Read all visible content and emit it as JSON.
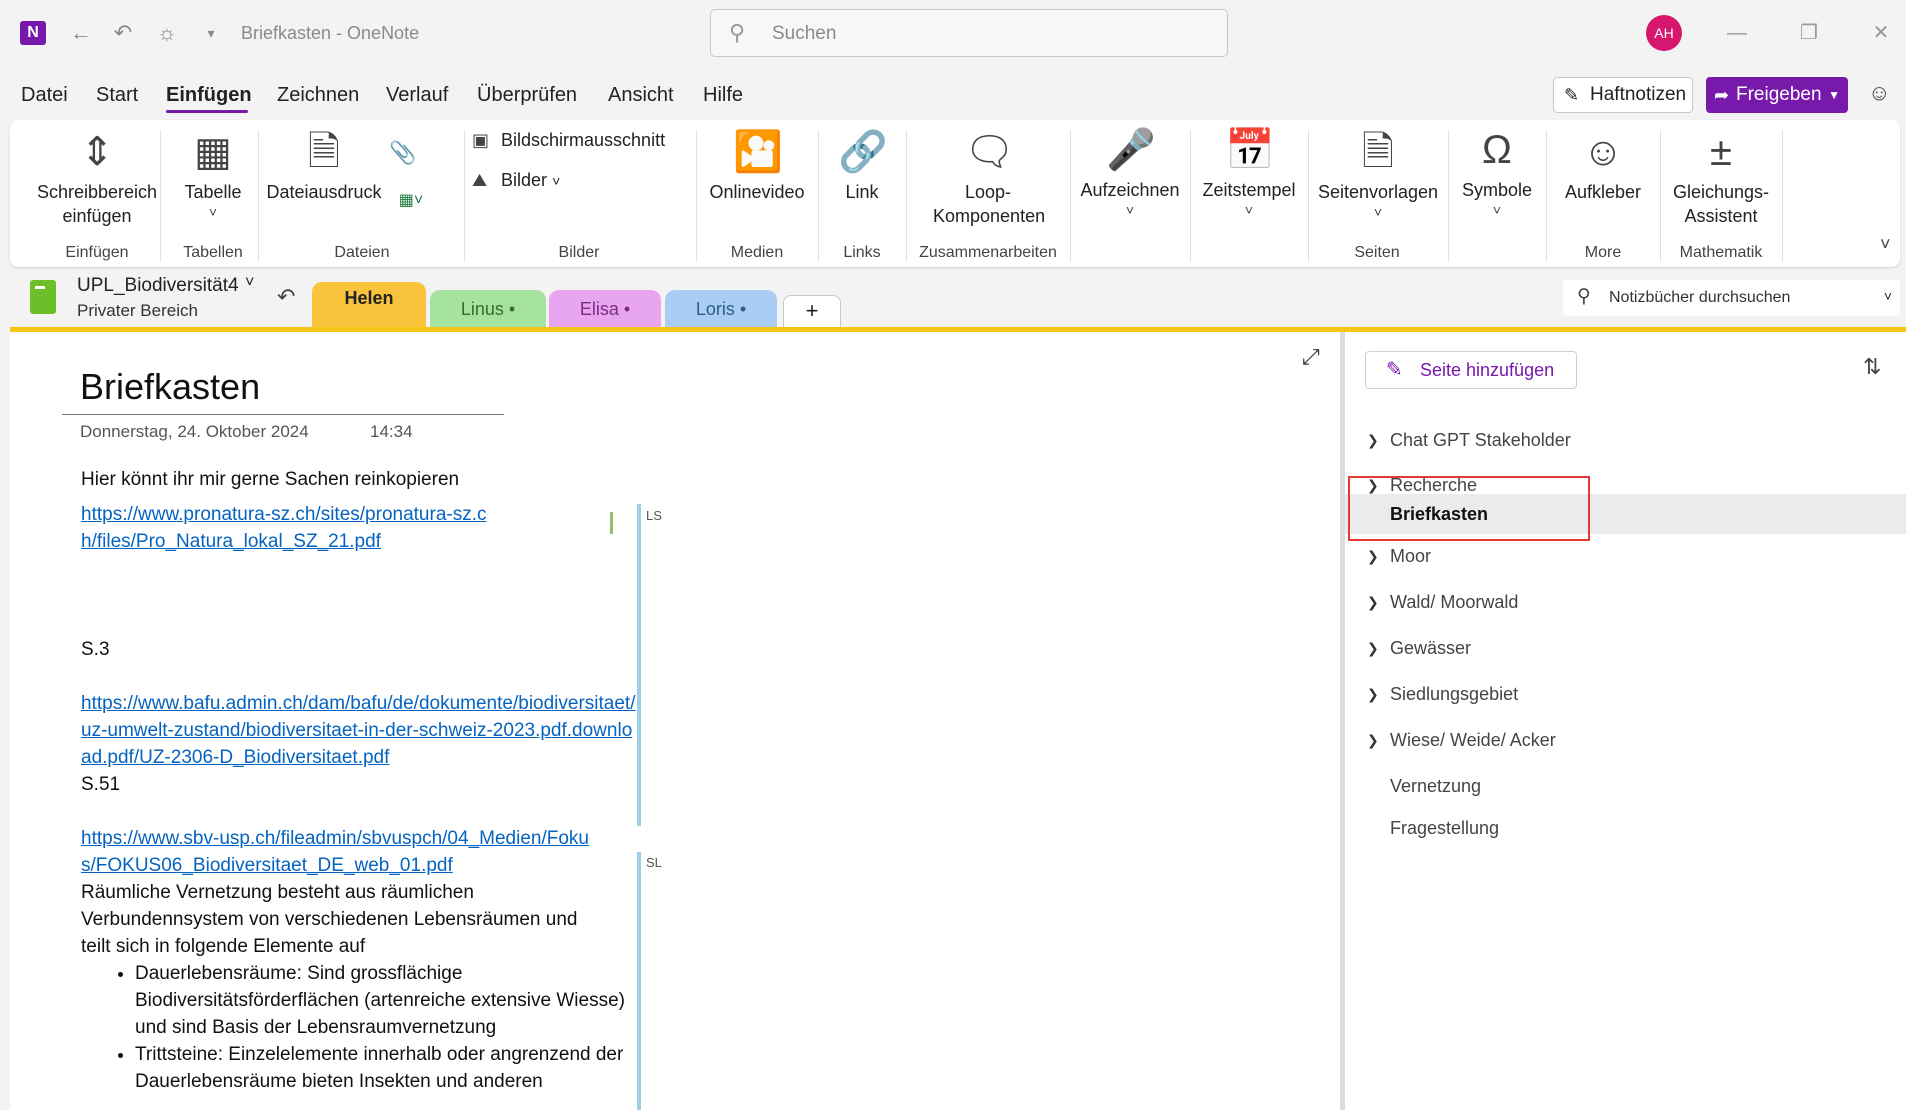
{
  "titlebar": {
    "app_logo": "N",
    "title": "Briefkasten  -  OneNote",
    "search_placeholder": "Suchen",
    "avatar_initials": "AH"
  },
  "menu": {
    "items": [
      "Datei",
      "Start",
      "Einfügen",
      "Zeichnen",
      "Verlauf",
      "Überprüfen",
      "Ansicht",
      "Hilfe"
    ],
    "active": "Einfügen",
    "sticky_notes": "Haftnotizen",
    "share": "Freigeben",
    "accent_color": "#7719aa"
  },
  "ribbon": {
    "insert_space": "Schreibbereich einfügen",
    "table": "Tabelle",
    "file_printout": "Dateiausdruck",
    "screen_clipping": "Bildschirmausschnitt",
    "pictures": "Bilder",
    "online_video": "Onlinevideo",
    "link": "Link",
    "loop": "Loop-Komponenten",
    "record": "Aufzeichnen",
    "timestamp": "Zeitstempel",
    "page_templates": "Seitenvorlagen",
    "symbols": "Symbole",
    "stickers": "Aufkleber",
    "equation": "Gleichungs-Assistent",
    "groups": {
      "insert": "Einfügen",
      "tables": "Tabellen",
      "files": "Dateien",
      "images": "Bilder",
      "media": "Medien",
      "links": "Links",
      "collab": "Zusammenarbeiten",
      "pages": "Seiten",
      "more": "More",
      "math": "Mathematik"
    }
  },
  "notebook": {
    "name": "UPL_Biodiversität4",
    "sub": "Privater Bereich",
    "search_placeholder": "Notizbücher durchsuchen",
    "sections": [
      {
        "label": "Helen",
        "color": "#f9c33c"
      },
      {
        "label": "Linus •",
        "color": "#a7e3a0"
      },
      {
        "label": "Elisa •",
        "color": "#e7a6ef"
      },
      {
        "label": "Loris •",
        "color": "#a9cdf5"
      }
    ],
    "add_section": "+"
  },
  "page": {
    "title": "Briefkasten",
    "date": "Donnerstag, 24. Oktober 2024",
    "time": "14:34",
    "intro": "Hier könnt ihr mir gerne Sachen reinkopieren",
    "link1": "https://www.pronatura-sz.ch/sites/pronatura-sz.ch/files/Pro_Natura_lokal_SZ_21.pdf",
    "s3": "S.3",
    "link2": "https://www.bafu.admin.ch/dam/bafu/de/dokumente/biodiversitaet/uz-umwelt-zustand/biodiversitaet-in-der-schweiz-2023.pdf.download.pdf/UZ-2306-D_Biodiversitaet.pdf",
    "s51": "S.51",
    "link3": "https://www.sbv-usp.ch/fileadmin/sbvuspch/04_Medien/Fokus/FOKUS06_Biodiversitaet_DE_web_01.pdf",
    "para": "Räumliche Vernetzung besteht aus räumlichen Verbundennsystem von verschiedenen Lebensräumen und teilt sich in folgende Elemente auf",
    "bullets": [
      "Dauerlebensräume: Sind grossflächige Biodiversitätsförderflächen (artenreiche extensive Wiesse) und sind Basis der Lebensraumvernetzung",
      "Trittsteine: Einzelelemente innerhalb oder angrenzend der Dauerlebensräume bieten Insekten und anderen"
    ],
    "author1": "LS",
    "author2": "SL"
  },
  "pagelist": {
    "add_page": "Seite hinzufügen",
    "items": [
      {
        "label": "Chat GPT Stakeholder",
        "chevron": true
      },
      {
        "label": "Recherche",
        "chevron": true
      },
      {
        "label": "Briefkasten",
        "chevron": false,
        "selected": true
      },
      {
        "label": "Moor",
        "chevron": true
      },
      {
        "label": "Wald/ Moorwald",
        "chevron": true
      },
      {
        "label": "Gewässer",
        "chevron": true
      },
      {
        "label": "Siedlungsgebiet",
        "chevron": true
      },
      {
        "label": "Wiese/ Weide/ Acker",
        "chevron": true
      },
      {
        "label": "Vernetzung",
        "chevron": false
      },
      {
        "label": "Fragestellung",
        "chevron": false
      }
    ]
  }
}
